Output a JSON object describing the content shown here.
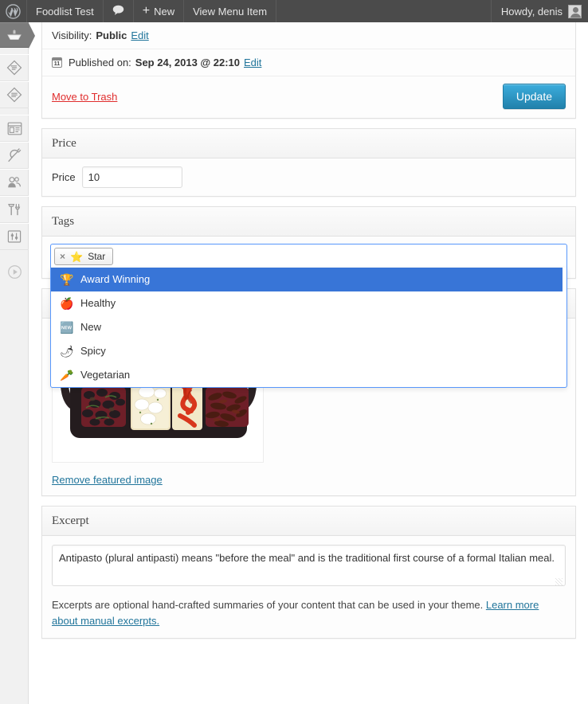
{
  "adminbar": {
    "logo_icon": "wordpress-icon",
    "site_title": "Foodlist Test",
    "comments_icon": "comment-bubble-icon",
    "new_plus": "+",
    "new_label": "New",
    "view_item": "View Menu Item",
    "howdy": "Howdy, denis",
    "avatar_icon": "avatar-icon"
  },
  "sidebar": {
    "items": [
      {
        "name": "foodlist",
        "icon": "dish-icon",
        "current": true
      },
      {
        "name": "posts",
        "icon": "diamond-lines-icon",
        "current": false
      },
      {
        "name": "pages",
        "icon": "diamond-lines-icon",
        "current": false
      },
      {
        "name": "appearance",
        "icon": "layout-icon",
        "current": false
      },
      {
        "name": "plugins",
        "icon": "plug-icon",
        "current": false
      },
      {
        "name": "users",
        "icon": "users-icon",
        "current": false
      },
      {
        "name": "tools",
        "icon": "hammer-wrench-icon",
        "current": false
      },
      {
        "name": "settings",
        "icon": "sliders-icon",
        "current": false
      },
      {
        "name": "collapse-menu",
        "icon": "collapse-arrow-icon",
        "current": false
      }
    ]
  },
  "publish": {
    "visibility_label": "Visibility:",
    "visibility_value": "Public",
    "visibility_edit": "Edit",
    "calendar_icon": "calendar-icon",
    "calendar_day": "11",
    "published_label": "Published on:",
    "published_value": "Sep 24, 2013 @ 22:10",
    "published_edit": "Edit",
    "trash_label": "Move to Trash",
    "update_label": "Update",
    "update_color": "#2181ab"
  },
  "price": {
    "panel_title": "Price",
    "field_label": "Price",
    "field_value": "10"
  },
  "tags": {
    "panel_title": "Tags",
    "selected": [
      {
        "label": "Star",
        "emoji": "⭐",
        "remove_icon": "close-icon"
      }
    ],
    "highlight_color": "#3875d7",
    "options": [
      {
        "label": "Award Winning",
        "emoji": "🏆",
        "highlighted": true
      },
      {
        "label": "Healthy",
        "emoji": "🍎",
        "highlighted": false
      },
      {
        "label": "New",
        "emoji": "🆕",
        "highlighted": false
      },
      {
        "label": "Spicy",
        "emoji": "🌶",
        "highlighted": false
      },
      {
        "label": "Vegetarian",
        "emoji": "🥕",
        "highlighted": false
      }
    ]
  },
  "featured": {
    "image_alt": "antipasto-platter-image",
    "remove_label": "Remove featured image"
  },
  "excerpt": {
    "panel_title": "Excerpt",
    "value": "Antipasto (plural antipasti) means \"before the meal\" and is the traditional first course of a formal Italian meal.",
    "help_text": "Excerpts are optional hand-crafted summaries of your content that can be used in your theme. ",
    "help_link": "Learn more about manual excerpts."
  }
}
